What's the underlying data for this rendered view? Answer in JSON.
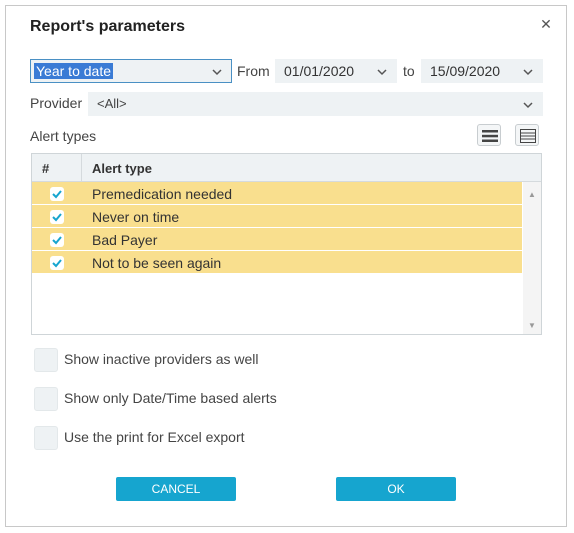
{
  "dialog": {
    "title": "Report's parameters"
  },
  "period": {
    "value": "Year to date"
  },
  "labels": {
    "from": "From",
    "to": "to",
    "provider": "Provider",
    "alert_types": "Alert types"
  },
  "from_date": "01/01/2020",
  "to_date": "15/09/2020",
  "provider": {
    "value": "<All>"
  },
  "grid": {
    "headers": {
      "num": "#",
      "type": "Alert type"
    },
    "rows": [
      {
        "label": "Premedication needed",
        "checked": true
      },
      {
        "label": "Never on time",
        "checked": true
      },
      {
        "label": "Bad Payer",
        "checked": true
      },
      {
        "label": "Not to be seen again",
        "checked": true
      }
    ]
  },
  "options": [
    {
      "label": "Show inactive providers as well",
      "checked": false
    },
    {
      "label": "Show only Date/Time based alerts",
      "checked": false
    },
    {
      "label": "Use the print for Excel export",
      "checked": false
    }
  ],
  "buttons": {
    "cancel": "CANCEL",
    "ok": "OK"
  },
  "colors": {
    "accent": "#16a5cf",
    "row_highlight": "#f9df8e",
    "check": "#16a5cf"
  }
}
